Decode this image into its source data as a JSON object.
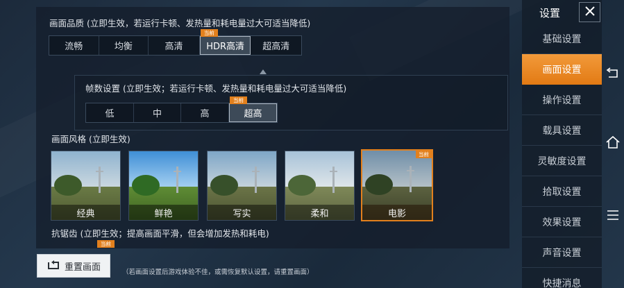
{
  "quality": {
    "title": "画面品质 (立即生效，若运行卡顿、发热量和耗电量过大可适当降低)",
    "current_tag": "当前",
    "options": [
      "流畅",
      "均衡",
      "高清",
      "HDR高清",
      "超高清"
    ],
    "selected": "HDR高清"
  },
  "fps": {
    "title": "帧数设置 (立即生效；若运行卡顿、发热量和耗电量过大可适当降低)",
    "current_tag": "当前",
    "options": [
      "低",
      "中",
      "高",
      "超高"
    ],
    "selected": "超高"
  },
  "style": {
    "title": "画面风格 (立即生效)",
    "current_tag": "当前",
    "options": [
      "经典",
      "鲜艳",
      "写实",
      "柔和",
      "电影"
    ],
    "selected": "电影"
  },
  "antialias": {
    "title": "抗锯齿 (立即生效；提高画面平滑，但会增加发热和耗电)"
  },
  "reset": {
    "label": "重置画面",
    "current_tag": "当前",
    "note": "（若画面设置后游戏体验不佳，或需恢复默认设置，请重置画面）"
  },
  "sidebar": {
    "title": "设置",
    "items": [
      "基础设置",
      "画面设置",
      "操作设置",
      "载具设置",
      "灵敏度设置",
      "拾取设置",
      "效果设置",
      "声音设置",
      "快捷消息"
    ],
    "active": "画面设置"
  },
  "icons": {
    "close": "close-icon",
    "reset": "reset-icon",
    "back": "back-icon",
    "home": "home-icon",
    "menu": "menu-icon"
  },
  "colors": {
    "accent": "#e2801d",
    "panel": "#141e2c",
    "selected_segment": "#3d4a58"
  }
}
